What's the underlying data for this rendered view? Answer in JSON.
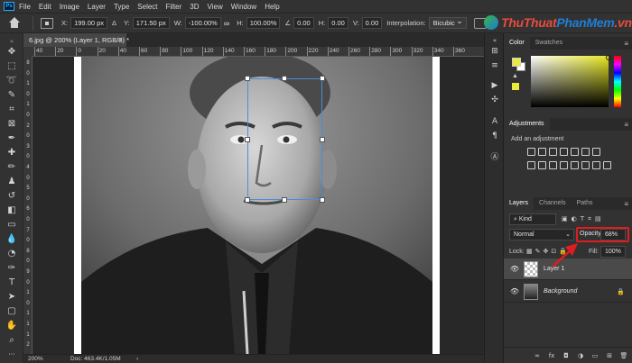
{
  "app": {
    "logo": "Ps",
    "menu": [
      "File",
      "Edit",
      "Image",
      "Layer",
      "Type",
      "Select",
      "Filter",
      "3D",
      "View",
      "Window",
      "Help"
    ]
  },
  "options": {
    "x_label": "X:",
    "x_value": "199.00 px",
    "y_label": "Y:",
    "y_value": "171.50 px",
    "w_label": "W:",
    "w_value": "-100.00%",
    "h_label": "H:",
    "h_value": "100.00%",
    "angle_value": "0.00",
    "h_skew_label": "H:",
    "h_skew_value": "0.00",
    "v_skew_label": "V:",
    "v_skew_value": "0.00",
    "interpolation_label": "Interpolation:",
    "interpolation_value": "Bicubic"
  },
  "watermark": {
    "part1": "ThuThuat",
    "part2": "PhanMem",
    "part3": ".vn"
  },
  "document": {
    "tab_title": "6.jpg @ 200% (Layer 1, RGB/8) *",
    "zoom": "200%",
    "doc_info": "Doc: 463.4K/1.05M"
  },
  "ruler": {
    "top": [
      "40",
      "20",
      "0",
      "20",
      "40",
      "60",
      "80",
      "100",
      "120",
      "140",
      "160",
      "180",
      "200",
      "220",
      "240",
      "260",
      "280",
      "300",
      "320",
      "340",
      "360"
    ],
    "left": [
      "8",
      "0",
      "1",
      "0",
      "1",
      "0",
      "2",
      "0",
      "3",
      "0",
      "4",
      "0",
      "5",
      "0",
      "6",
      "0",
      "7",
      "0",
      "8",
      "0",
      "9",
      "0",
      "1",
      "0",
      "1",
      "1",
      "1",
      "2"
    ]
  },
  "color_panel": {
    "tabs": [
      "Color",
      "Swatches"
    ],
    "foreground": "#eaea3c",
    "background": "#ffffff"
  },
  "adjustments": {
    "tab": "Adjustments",
    "subtitle": "Add an adjustment"
  },
  "layers": {
    "tabs": [
      "Layers",
      "Channels",
      "Paths"
    ],
    "filter_kind": "Kind",
    "blend_mode": "Normal",
    "opacity_label": "Opacity:",
    "opacity_value": "68%",
    "lock_label": "Lock:",
    "fill_label": "Fill:",
    "fill_value": "100%",
    "items": [
      {
        "name": "Layer 1"
      },
      {
        "name": "Background"
      }
    ],
    "footer_icons": [
      "link-icon",
      "fx-icon",
      "mask-icon",
      "adjustment-icon",
      "group-icon",
      "new-layer-icon",
      "trash-icon"
    ]
  },
  "colors": {
    "accent_selection": "#4a8dd8",
    "highlight": "#e11c1c"
  }
}
